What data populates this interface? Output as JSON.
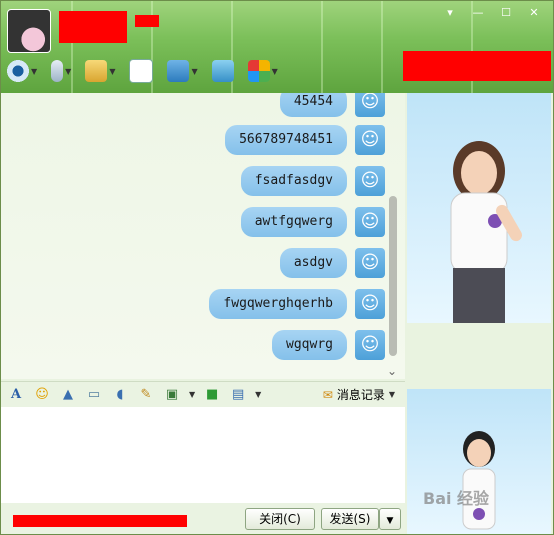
{
  "window": {
    "controls": [
      "▾",
      "—",
      "☐",
      "✕"
    ]
  },
  "messages": [
    "45454",
    "566789748451",
    "fsadfasdgv",
    "awtfgqwerg",
    "asdgv",
    "fwgqwerghqerhb",
    "wgqwrg"
  ],
  "format_toolbar": {
    "history_label": "消息记录"
  },
  "bottom": {
    "close_label": "关闭(C)",
    "send_label": "发送(S)"
  },
  "watermark": "Bai 经验",
  "colors": {
    "accent_green": "#6fb44c",
    "bubble_blue": "#9ccdf0",
    "redaction": "#ff0000"
  }
}
